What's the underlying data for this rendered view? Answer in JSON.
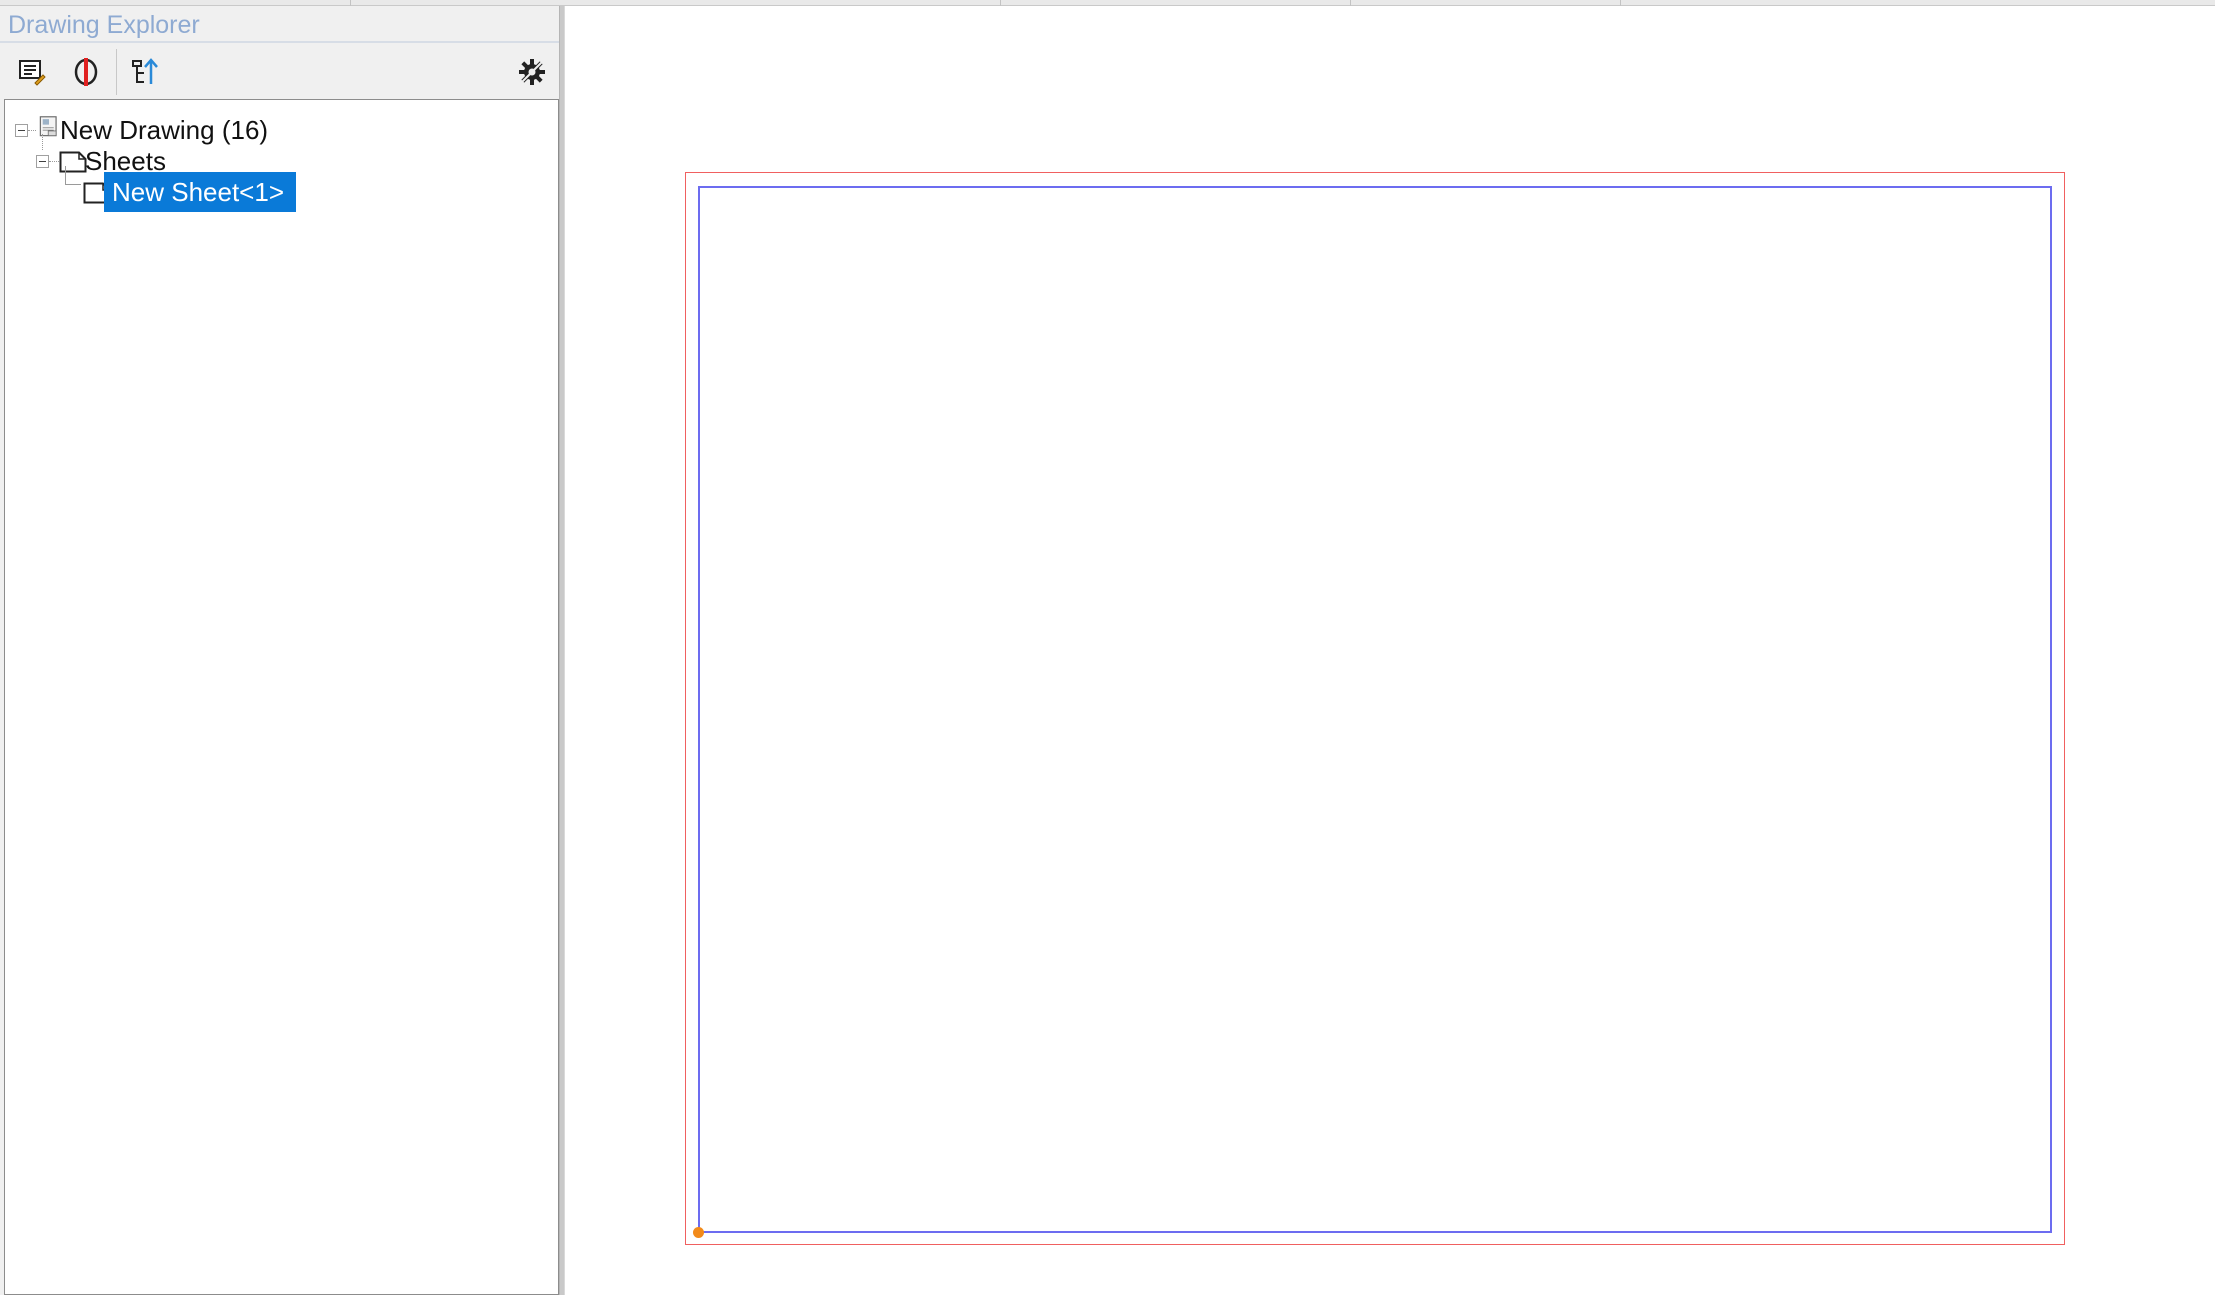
{
  "panel": {
    "title": "Drawing Explorer"
  },
  "toolbar": {
    "buttons": [
      {
        "name": "properties",
        "icon": "properties-list-icon"
      },
      {
        "name": "section",
        "icon": "red-section-icon"
      },
      {
        "name": "tree-structure",
        "icon": "tree-structure-icon"
      }
    ],
    "settings_icon": "gear-icon"
  },
  "tree": {
    "root": {
      "label": "New Drawing (16)",
      "icon": "drawing-icon"
    },
    "sheets": {
      "label": "Sheets",
      "icon": "sheet-icon"
    },
    "sheet1": {
      "label": "New Sheet<1>",
      "icon": "sheet-icon",
      "selected": true
    }
  },
  "colors": {
    "selection": "#0a7ad8",
    "title_text": "#8eaad2",
    "sheet_border_outer": "#f06060",
    "sheet_border_inner": "#6c6cf0",
    "origin_marker": "#f28a1a"
  }
}
